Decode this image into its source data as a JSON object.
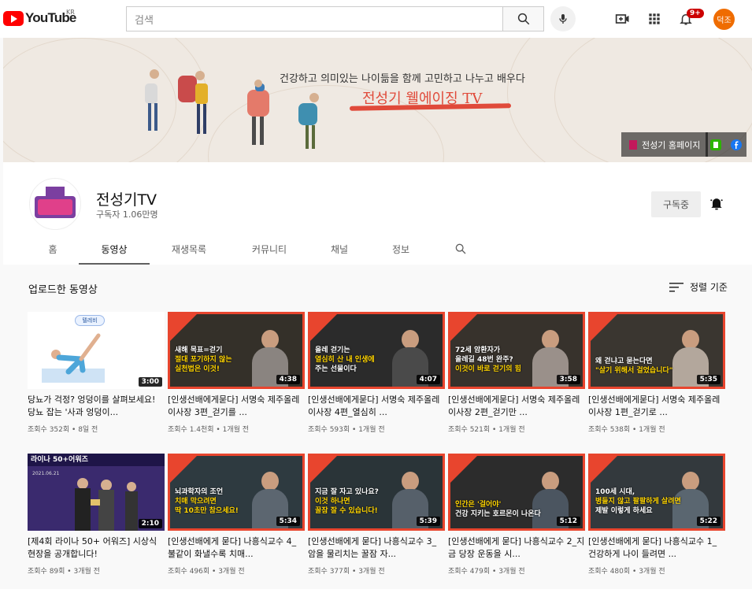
{
  "header": {
    "logo_text": "YouTube",
    "region": "KR",
    "search_placeholder": "검색",
    "notification_count": "9+",
    "avatar_initials": "덕조"
  },
  "banner": {
    "tagline": "건강하고 의미있는 나이듦을 함께 고민하고 나누고 배우다",
    "title": "전성기 웰에이징 TV",
    "homepage_link": "전성기 홈페이지"
  },
  "channel": {
    "avatar_text": "전성기",
    "avatar_tv": "TV",
    "name": "전성기TV",
    "subscribers": "구독자 1.06만명",
    "subscribe_label": "구독중"
  },
  "tabs": [
    {
      "label": "홈"
    },
    {
      "label": "동영상"
    },
    {
      "label": "재생목록"
    },
    {
      "label": "커뮤니티"
    },
    {
      "label": "채널"
    },
    {
      "label": "정보"
    }
  ],
  "active_tab": "동영상",
  "section": {
    "title": "업로드한 동영상",
    "sort_label": "정렬 기준"
  },
  "colors": {
    "accent": "#e8452e",
    "caption_yellow": "#ffd400",
    "youtube_red": "#ff0000"
  },
  "videos": [
    {
      "title": "당뇨가 걱정? 엉덩이를 살펴보세요! 당뇨 잡는 '사과 엉덩이...",
      "meta": "조회수 352회 • 8일 전",
      "duration": "3:00",
      "cap1": "",
      "cap2": "",
      "badge": "텔레비"
    },
    {
      "title": "[인생선배에게묻다] 서명숙 제주올레 이사장 3편_걷기를 ...",
      "meta": "조회수 1.4천회 • 1개월 전",
      "duration": "4:38",
      "cap1": "새해 목표=걷기",
      "cap2": "절대 포기하지 않는",
      "cap3": "실천법은 이것!"
    },
    {
      "title": "[인생선배에게묻다] 서명숙 제주올레 이사장 4편_열심히 ...",
      "meta": "조회수 593회 • 1개월 전",
      "duration": "4:07",
      "cap1": "올레 걷기는",
      "cap2": "열심히 산 내 인생에",
      "cap3": "주는 선물이다"
    },
    {
      "title": "[인생선배에게묻다] 서명숙 제주올레 이사장 2편_걷기만 ...",
      "meta": "조회수 521회 • 1개월 전",
      "duration": "3:58",
      "cap1": "72세 암환자가",
      "cap2": "올레길 48번 완주?",
      "cap3": "이것이 바로 걷기의 힘"
    },
    {
      "title": "[인생선배에게묻다] 서명숙 제주올레 이사장 1편_걷기로 ...",
      "meta": "조회수 538회 • 1개월 전",
      "duration": "5:35",
      "cap1": "왜 걷냐고 묻는다면",
      "cap2": "\"살기 위해서 걸었습니다\"",
      "cap3": ""
    },
    {
      "title": "[제4회 라이나 50+ 어워즈] 시상식 현장을 공개합니다!",
      "meta": "조회수 89회 • 3개월 전",
      "duration": "2:10",
      "cap1": "라이나 50+어워즈",
      "cap2": "2021.06.21",
      "cap3": ""
    },
    {
      "title": "[인생선배에게 묻다] 나흥식교수 4_ 불같이 화낼수록 치매...",
      "meta": "조회수 496회 • 3개월 전",
      "duration": "5:34",
      "cap1": "뇌과학자의 조언",
      "cap2": "치매 막으려면",
      "cap3": "딱 10초만 참으세요!"
    },
    {
      "title": "[인생선배에게 묻다] 나흥식교수 3_ 암을 물리치는 꿀잠 자...",
      "meta": "조회수 377회 • 3개월 전",
      "duration": "5:39",
      "cap1": "지금 잘 자고 있나요?",
      "cap2": "이것 하나면",
      "cap3": "꿀잠 잘 수 있습니다!"
    },
    {
      "title": "[인생선배에게 묻다] 나흥식교수 2_지금 당장 운동을 시...",
      "meta": "조회수 479회 • 3개월 전",
      "duration": "5:12",
      "cap1": "인간은 '걸어야'",
      "cap2": "건강 지키는 호르몬이 나온다",
      "cap3": ""
    },
    {
      "title": "[인생선배에게 묻다] 나흥식교수 1_ 건강하게 나이 들려면 ...",
      "meta": "조회수 480회 • 3개월 전",
      "duration": "5:22",
      "cap1": "100세 시대,",
      "cap2": "병들지 않고 팔팔하게 살려면",
      "cap3": "제발 이렇게 하세요"
    }
  ]
}
